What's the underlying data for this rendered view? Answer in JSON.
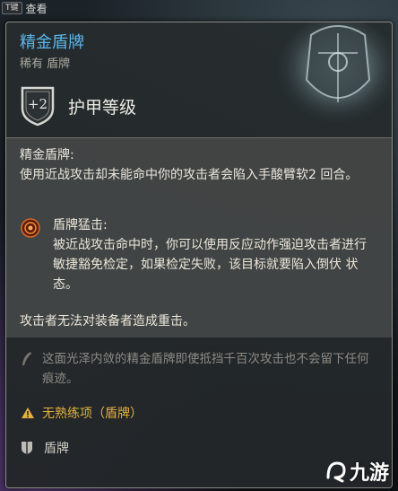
{
  "hint": {
    "key": "T键",
    "action": "查看"
  },
  "item": {
    "name": "精金盾牌",
    "rarity_type": "稀有 盾牌",
    "armor_bonus": "+2",
    "armor_label": "护甲等级"
  },
  "effects": {
    "main_title": "精金盾牌:",
    "main_desc": "使用近战攻击却未能命中你的攻击者会陷入手酸臂软2 回合。",
    "sub_title": "盾牌猛击:",
    "sub_desc": "被近战攻击命中时，你可以使用反应动作强迫攻击者进行敏捷豁免检定，如果检定失败，该目标就要陷入倒伏 状态。",
    "note": "攻击者无法对装备者造成重击。"
  },
  "lore": "这面光泽内敛的精金盾牌即使抵挡千百次攻击也不会留下任何痕迹。",
  "proficiency_warning": "无熟练项（盾牌）",
  "item_type": "盾牌",
  "watermark": "九游",
  "colors": {
    "title": "#5ab6ea",
    "warning": "#e4b13b",
    "panel": "#444646"
  },
  "icons": {
    "armor": "shield-outline-icon",
    "subability": "shield-bash-icon",
    "lore": "quill-icon",
    "warning": "warning-triangle-icon",
    "type": "shield-small-icon",
    "watermark": "jiuyou-logo-icon"
  }
}
